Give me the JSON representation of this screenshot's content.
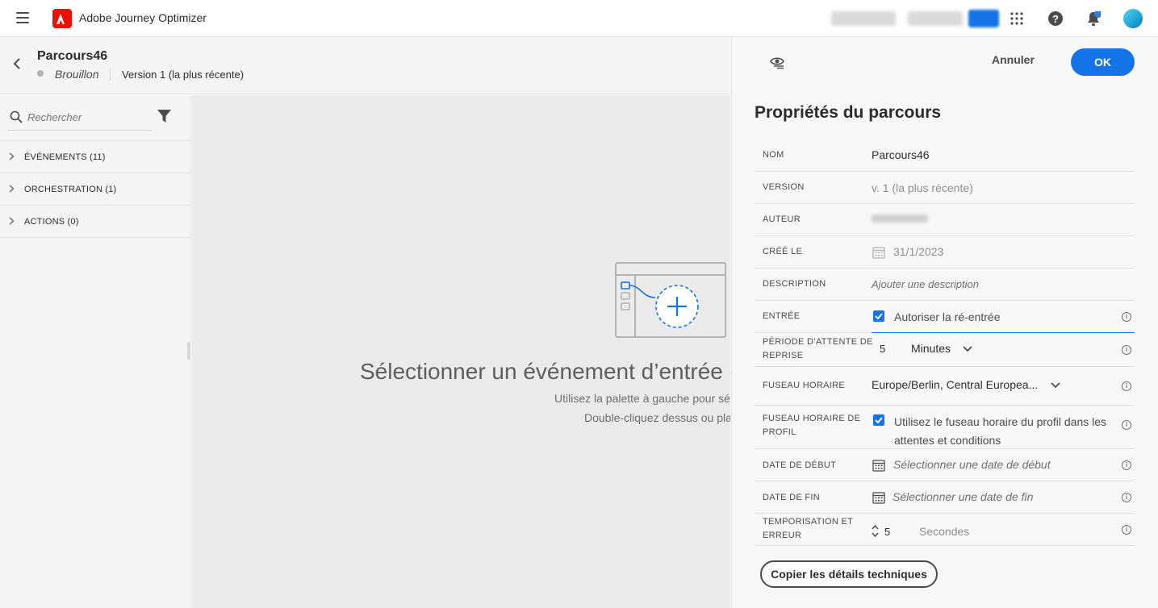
{
  "app": {
    "title": "Adobe Journey Optimizer",
    "blurred_user_labels": [
      "CJM Prod NLD2",
      "Prod (NLD2)",
      "Prod"
    ],
    "accent": "#1473e6",
    "brand": "#eb1000"
  },
  "journey": {
    "name": "Parcours46",
    "status": "Brouillon",
    "version": "Version 1 (la plus récente)"
  },
  "palette": {
    "search_placeholder": "Rechercher",
    "categories": [
      {
        "label": "ÉVÉNEMENTS (11)"
      },
      {
        "label": "ORCHESTRATION (1)"
      },
      {
        "label": "ACTIONS (0)"
      }
    ]
  },
  "canvas": {
    "title": "Sélectionner un événement d’entrée o",
    "hint1": "Utilisez la palette à gauche pour séle",
    "hint2": "Double-cliquez dessus ou plac"
  },
  "panel": {
    "cancel_label": "Annuler",
    "ok_label": "OK",
    "title": "Propriétés du parcours",
    "copy_label": "Copier les détails techniques",
    "fields": {
      "nom": {
        "label": "NOM",
        "value": "Parcours46"
      },
      "version": {
        "label": "VERSION",
        "value": "v. 1 (la plus récente)"
      },
      "auteur": {
        "label": "AUTEUR"
      },
      "cree_le": {
        "label": "CRÉÉ LE",
        "value": "31/1/2023"
      },
      "description": {
        "label": "DESCRIPTION",
        "placeholder": "Ajouter une description"
      },
      "entree": {
        "label": "ENTRÉE",
        "checkbox_label": "Autoriser la ré-entrée",
        "checked": true
      },
      "periode": {
        "label_line1": "PÉRIODE D’ATTENTE DE",
        "label_line2": "REPRISE",
        "value": "5",
        "unit": "Minutes"
      },
      "fuseau": {
        "label": "FUSEAU HORAIRE",
        "value": "Europe/Berlin, Central Europea..."
      },
      "fuseau_profil": {
        "label_line1": "FUSEAU HORAIRE DE",
        "label_line2": "PROFIL",
        "checkbox_line1": "Utilisez le fuseau horaire du profil dans les",
        "checkbox_line2": "attentes et conditions",
        "checked": true
      },
      "date_debut": {
        "label": "DATE DE DÉBUT",
        "placeholder": "Sélectionner une date de début"
      },
      "date_fin": {
        "label": "DATE DE FIN",
        "placeholder": "Sélectionner une date de fin"
      },
      "tempo": {
        "label_line1": "TEMPORISATION ET",
        "label_line2": "ERREUR",
        "value": "5",
        "unit": "Secondes"
      }
    }
  }
}
